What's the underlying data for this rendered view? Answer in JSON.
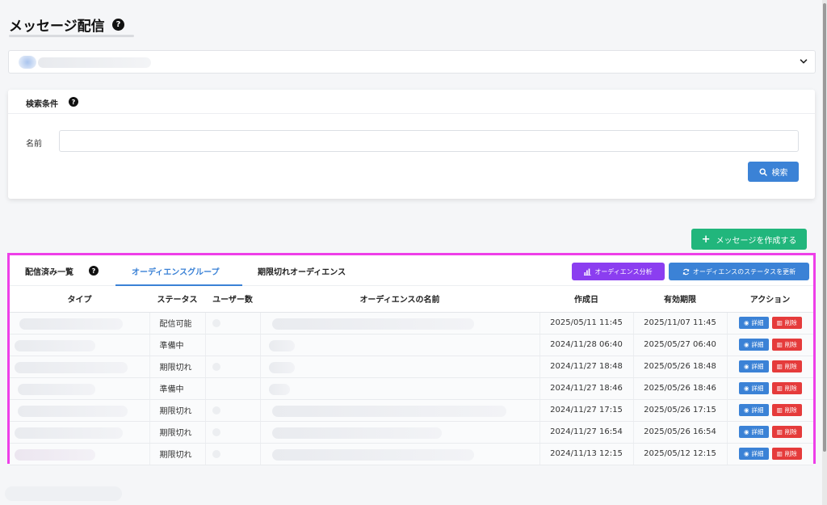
{
  "header": {
    "title": "メッセージ配信",
    "help": "?"
  },
  "search": {
    "title": "検索条件",
    "help": "?",
    "name_label": "名前",
    "name_value": "",
    "name_placeholder": "",
    "button_label": "検索"
  },
  "create_button": {
    "icon": "+",
    "label": "メッセージを作成する"
  },
  "tabs": [
    {
      "label": "配信済み一覧",
      "active": false
    },
    {
      "label": "オーディエンスグループ",
      "active": true
    },
    {
      "label": "期限切れオーディエンス",
      "active": false
    }
  ],
  "tab_help": "?",
  "actions": {
    "analysis_label": "オーディエンス分析",
    "update_status_label": "オーディエンスのステータスを更新"
  },
  "table": {
    "columns": [
      "タイプ",
      "ステータス",
      "ユーザー数",
      "オーディエンスの名前",
      "作成日",
      "有効期限",
      "アクション"
    ],
    "rows": [
      {
        "status": "配信可能",
        "created": "2025/05/11 11:45",
        "expires": "2025/11/07 11:45"
      },
      {
        "status": "準備中",
        "created": "2024/11/28 06:40",
        "expires": "2025/05/27 06:40"
      },
      {
        "status": "期限切れ",
        "created": "2024/11/27 18:48",
        "expires": "2025/05/26 18:48"
      },
      {
        "status": "準備中",
        "created": "2024/11/27 18:46",
        "expires": "2025/05/26 18:46"
      },
      {
        "status": "期限切れ",
        "created": "2024/11/27 17:15",
        "expires": "2025/05/26 17:15"
      },
      {
        "status": "期限切れ",
        "created": "2024/11/27 16:54",
        "expires": "2025/05/26 16:54"
      },
      {
        "status": "期限切れ",
        "created": "2024/11/13 12:15",
        "expires": "2025/05/12 12:15"
      }
    ],
    "detail_label": "詳細",
    "delete_label": "削除"
  },
  "colors": {
    "primary": "#3b82d6",
    "success": "#21b67c",
    "purple": "#8b3ef0",
    "danger": "#e53b3b",
    "highlight": "#ee3fe8"
  }
}
